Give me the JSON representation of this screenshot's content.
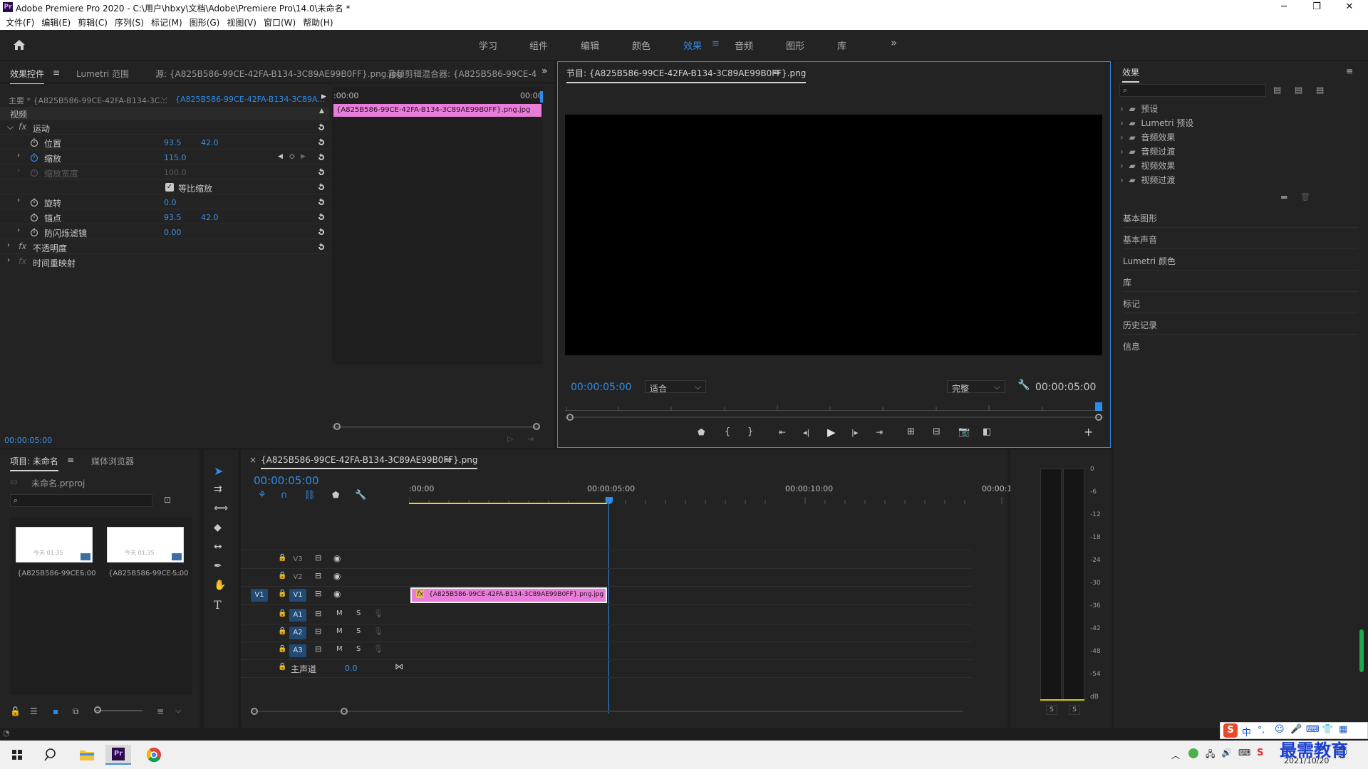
{
  "window": {
    "title": "Adobe Premiere Pro 2020 - C:\\用户\\hbxy\\文档\\Adobe\\Premiere Pro\\14.0\\未命名 *",
    "logo_text": "Pr"
  },
  "menu": [
    "文件(F)",
    "编辑(E)",
    "剪辑(C)",
    "序列(S)",
    "标记(M)",
    "图形(G)",
    "视图(V)",
    "窗口(W)",
    "帮助(H)"
  ],
  "workspaces": {
    "items": [
      "学习",
      "组件",
      "编辑",
      "颜色",
      "效果",
      "音频",
      "图形",
      "库"
    ],
    "active": "效果",
    "overflow": "»"
  },
  "effect_controls": {
    "tabs": [
      "效果控件",
      "Lumetri 范围",
      "源: {A825B586-99CE-42FA-B134-3C89AE99B0FF}.png.jpg",
      "音频剪辑混合器: {A825B586-99CE-4"
    ],
    "menu_glyph": "≡",
    "master": "主要 * {A825B586-99CE-42FA-B134-3C...",
    "clip": "{A825B586-99CE-42FA-B134-3C89A...",
    "ruler_start": ":00:00",
    "ruler_end": "00:00",
    "clip_bar": "{A825B586-99CE-42FA-B134-3C89AE99B0FF}.png.jpg",
    "section": "视频",
    "motion": "运动",
    "fx_glyph": "fx",
    "properties": {
      "position": {
        "label": "位置",
        "x": "93.5",
        "y": "42.0"
      },
      "scale": {
        "label": "缩放",
        "value": "115.0"
      },
      "scale_width": {
        "label": "缩放宽度",
        "value": "100.0"
      },
      "uniform": {
        "label": "等比缩放"
      },
      "rotation": {
        "label": "旋转",
        "value": "0.0"
      },
      "anchor": {
        "label": "锚点",
        "x": "93.5",
        "y": "42.0"
      },
      "flicker": {
        "label": "防闪烁滤镜",
        "value": "0.00"
      }
    },
    "opacity": "不透明度",
    "time_remap": "时间重映射",
    "timecode": "00:00:05:00"
  },
  "program": {
    "title": "节目: {A825B586-99CE-42FA-B134-3C89AE99B0FF}.png",
    "menu_glyph": "≡",
    "timecode": "00:00:05:00",
    "fit": "适合",
    "quality": "完整",
    "duration": "00:00:05:00"
  },
  "effects_panel": {
    "title": "效果",
    "menu_glyph": "≡",
    "search_placeholder": "",
    "folders": [
      "预设",
      "Lumetri 预设",
      "音频效果",
      "音频过渡",
      "视频效果",
      "视频过渡"
    ],
    "panels": [
      "基本图形",
      "基本声音",
      "Lumetri 颜色",
      "库",
      "标记",
      "历史记录",
      "信息"
    ]
  },
  "project": {
    "tabs": [
      "项目: 未命名",
      "媒体浏览器"
    ],
    "menu_glyph": "≡",
    "file": "未命名.prproj",
    "items": [
      {
        "name": "{A825B586-99CE-...",
        "duration": "5:00",
        "thumb_text": "今天 01:35"
      },
      {
        "name": "{A825B586-99CE-...",
        "duration": "5:00",
        "thumb_text": "今天 01:35"
      }
    ]
  },
  "timeline": {
    "close_glyph": "×",
    "tab": "{A825B586-99CE-42FA-B134-3C89AE99B0FF}.png",
    "menu_glyph": "≡",
    "timecode": "00:00:05:00",
    "ruler": [
      ":00:00",
      "00:00:05:00",
      "00:00:10:00",
      "00:00:1"
    ],
    "video_tracks": [
      "V3",
      "V2",
      "V1"
    ],
    "source_patch": "V1",
    "audio_tracks": [
      "A1",
      "A2",
      "A3"
    ],
    "audio_m": "M",
    "audio_s": "S",
    "master": "主声道",
    "master_value": "0.0",
    "clip_label": "{A825B586-99CE-42FA-B134-3C89AE99B0FF}.png.jpg",
    "clip_fx": "fx"
  },
  "meter": {
    "scale": [
      "0",
      "-6",
      "-12",
      "-18",
      "-24",
      "-30",
      "-36",
      "-42",
      "-48",
      "-54",
      "dB"
    ],
    "solo": [
      "S",
      "S"
    ]
  },
  "taskbar": {
    "ime": "中",
    "date": "2021/10/20",
    "watermark": "最需教育"
  },
  "colors": {
    "accent_blue": "#2d8ceb",
    "clip_pink": "#e87ed8",
    "playhead": "#2d8ceb"
  }
}
